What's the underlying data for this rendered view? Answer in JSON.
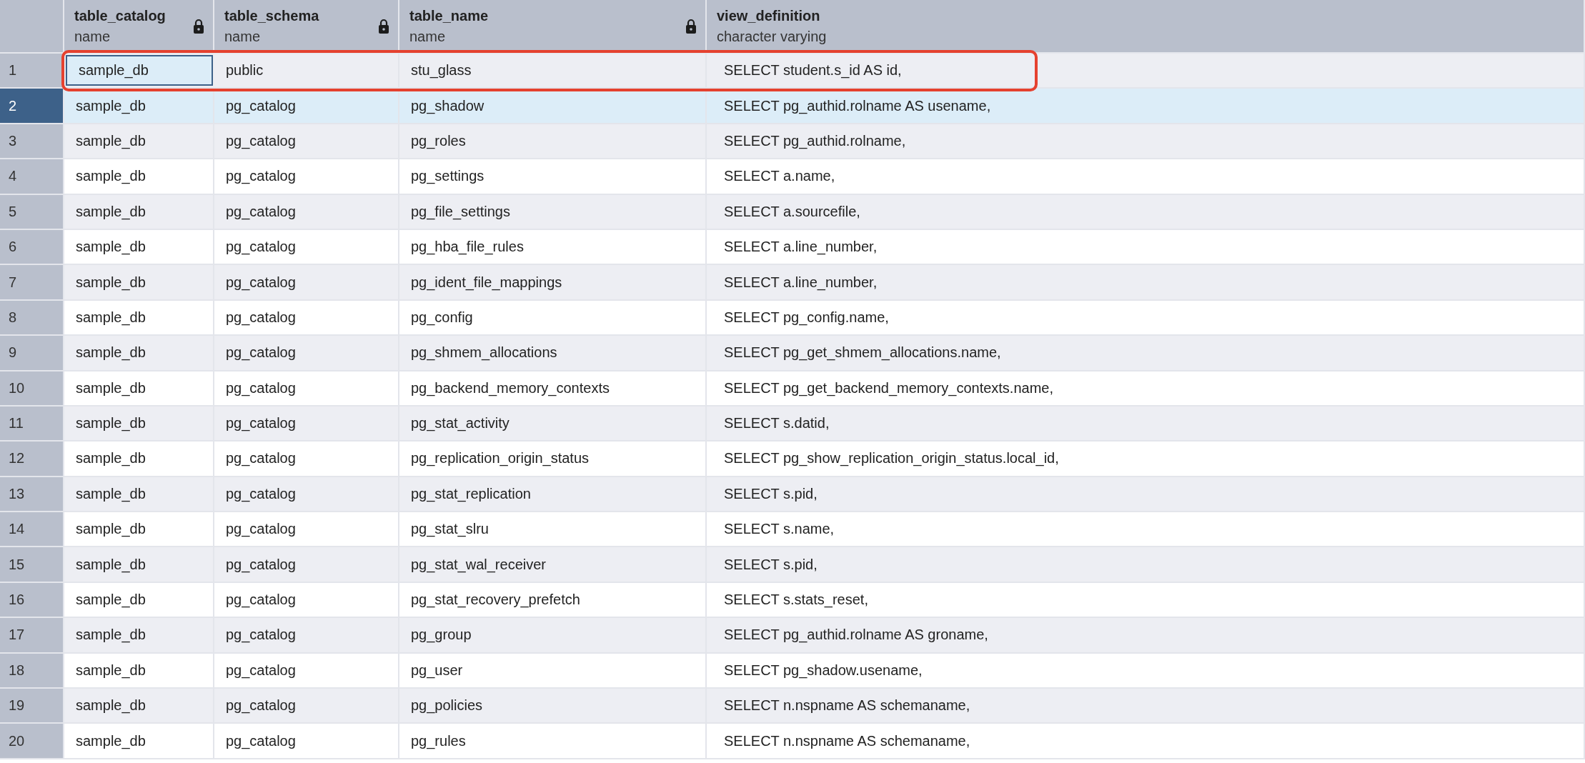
{
  "table": {
    "columns": [
      {
        "name": "table_catalog",
        "type": "name",
        "locked": true
      },
      {
        "name": "table_schema",
        "type": "name",
        "locked": true
      },
      {
        "name": "table_name",
        "type": "name",
        "locked": true
      },
      {
        "name": "view_definition",
        "type": "character varying",
        "locked": false
      }
    ],
    "rows": [
      {
        "number": "1",
        "selected": false,
        "focused": true,
        "highlighted": true,
        "cells": [
          "sample_db",
          "public",
          "stu_glass",
          "SELECT student.s_id AS id,"
        ]
      },
      {
        "number": "2",
        "selected": true,
        "focused": false,
        "highlighted": false,
        "cells": [
          "sample_db",
          "pg_catalog",
          "pg_shadow",
          "SELECT pg_authid.rolname AS usename,"
        ]
      },
      {
        "number": "3",
        "selected": false,
        "focused": false,
        "highlighted": false,
        "cells": [
          "sample_db",
          "pg_catalog",
          "pg_roles",
          "SELECT pg_authid.rolname,"
        ]
      },
      {
        "number": "4",
        "selected": false,
        "focused": false,
        "highlighted": false,
        "cells": [
          "sample_db",
          "pg_catalog",
          "pg_settings",
          "SELECT a.name,"
        ]
      },
      {
        "number": "5",
        "selected": false,
        "focused": false,
        "highlighted": false,
        "cells": [
          "sample_db",
          "pg_catalog",
          "pg_file_settings",
          "SELECT a.sourcefile,"
        ]
      },
      {
        "number": "6",
        "selected": false,
        "focused": false,
        "highlighted": false,
        "cells": [
          "sample_db",
          "pg_catalog",
          "pg_hba_file_rules",
          "SELECT a.line_number,"
        ]
      },
      {
        "number": "7",
        "selected": false,
        "focused": false,
        "highlighted": false,
        "cells": [
          "sample_db",
          "pg_catalog",
          "pg_ident_file_mappings",
          "SELECT a.line_number,"
        ]
      },
      {
        "number": "8",
        "selected": false,
        "focused": false,
        "highlighted": false,
        "cells": [
          "sample_db",
          "pg_catalog",
          "pg_config",
          "SELECT pg_config.name,"
        ]
      },
      {
        "number": "9",
        "selected": false,
        "focused": false,
        "highlighted": false,
        "cells": [
          "sample_db",
          "pg_catalog",
          "pg_shmem_allocations",
          "SELECT pg_get_shmem_allocations.name,"
        ]
      },
      {
        "number": "10",
        "selected": false,
        "focused": false,
        "highlighted": false,
        "cells": [
          "sample_db",
          "pg_catalog",
          "pg_backend_memory_contexts",
          "SELECT pg_get_backend_memory_contexts.name,"
        ]
      },
      {
        "number": "11",
        "selected": false,
        "focused": false,
        "highlighted": false,
        "cells": [
          "sample_db",
          "pg_catalog",
          "pg_stat_activity",
          "SELECT s.datid,"
        ]
      },
      {
        "number": "12",
        "selected": false,
        "focused": false,
        "highlighted": false,
        "cells": [
          "sample_db",
          "pg_catalog",
          "pg_replication_origin_status",
          "SELECT pg_show_replication_origin_status.local_id,"
        ]
      },
      {
        "number": "13",
        "selected": false,
        "focused": false,
        "highlighted": false,
        "cells": [
          "sample_db",
          "pg_catalog",
          "pg_stat_replication",
          "SELECT s.pid,"
        ]
      },
      {
        "number": "14",
        "selected": false,
        "focused": false,
        "highlighted": false,
        "cells": [
          "sample_db",
          "pg_catalog",
          "pg_stat_slru",
          "SELECT s.name,"
        ]
      },
      {
        "number": "15",
        "selected": false,
        "focused": false,
        "highlighted": false,
        "cells": [
          "sample_db",
          "pg_catalog",
          "pg_stat_wal_receiver",
          "SELECT s.pid,"
        ]
      },
      {
        "number": "16",
        "selected": false,
        "focused": false,
        "highlighted": false,
        "cells": [
          "sample_db",
          "pg_catalog",
          "pg_stat_recovery_prefetch",
          "SELECT s.stats_reset,"
        ]
      },
      {
        "number": "17",
        "selected": false,
        "focused": false,
        "highlighted": false,
        "cells": [
          "sample_db",
          "pg_catalog",
          "pg_group",
          "SELECT pg_authid.rolname AS groname,"
        ]
      },
      {
        "number": "18",
        "selected": false,
        "focused": false,
        "highlighted": false,
        "cells": [
          "sample_db",
          "pg_catalog",
          "pg_user",
          "SELECT pg_shadow.usename,"
        ]
      },
      {
        "number": "19",
        "selected": false,
        "focused": false,
        "highlighted": false,
        "cells": [
          "sample_db",
          "pg_catalog",
          "pg_policies",
          "SELECT n.nspname AS schemaname,"
        ]
      },
      {
        "number": "20",
        "selected": false,
        "focused": false,
        "highlighted": false,
        "cells": [
          "sample_db",
          "pg_catalog",
          "pg_rules",
          "SELECT n.nspname AS schemaname,"
        ]
      }
    ]
  }
}
